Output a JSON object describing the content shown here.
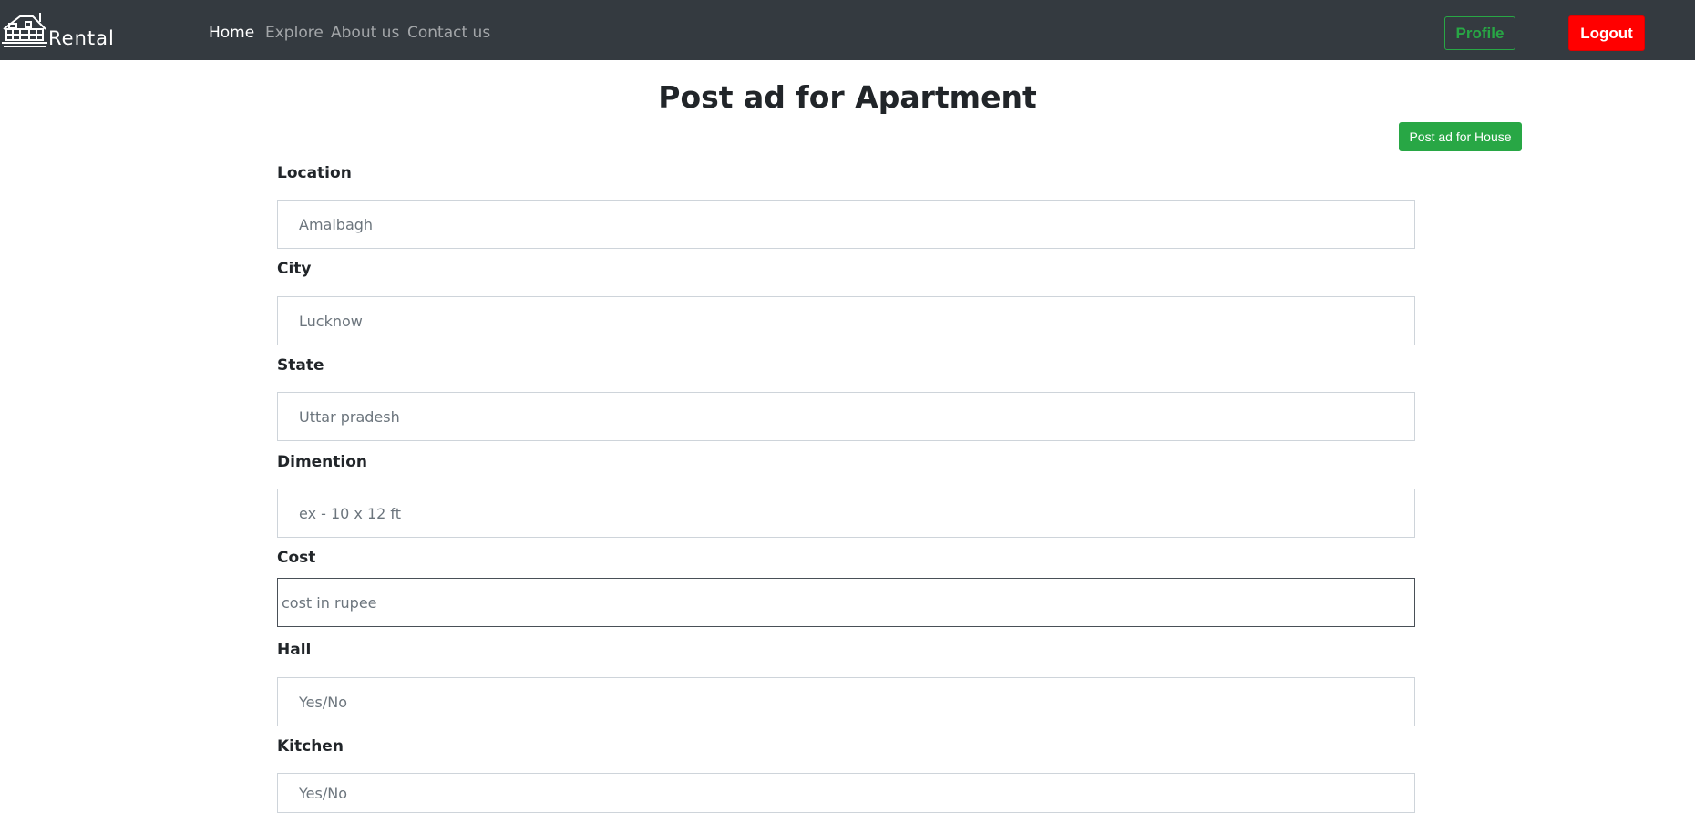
{
  "navbar": {
    "brand_text": "Rental",
    "links": [
      "Home",
      "Explore",
      "About us",
      "Contact us"
    ],
    "profile_label": "Profile",
    "logout_label": "Logout"
  },
  "page": {
    "title": "Post ad for Apartment",
    "switch_button_label": "Post ad for House"
  },
  "form": {
    "fields": [
      {
        "label": "Location",
        "placeholder": "Amalbagh",
        "value": ""
      },
      {
        "label": "City",
        "placeholder": "Lucknow",
        "value": ""
      },
      {
        "label": "State",
        "placeholder": "Uttar pradesh",
        "value": ""
      },
      {
        "label": "Dimention",
        "placeholder": "ex - 10 x 12 ft",
        "value": ""
      },
      {
        "label": "Cost",
        "placeholder": "cost in rupee",
        "value": ""
      },
      {
        "label": "Hall",
        "placeholder": "Yes/No",
        "value": ""
      },
      {
        "label": "Kitchen",
        "placeholder": "Yes/No",
        "value": ""
      }
    ]
  },
  "colors": {
    "navbar_bg": "#343a40",
    "success": "#28a745",
    "danger": "#ff0000"
  }
}
